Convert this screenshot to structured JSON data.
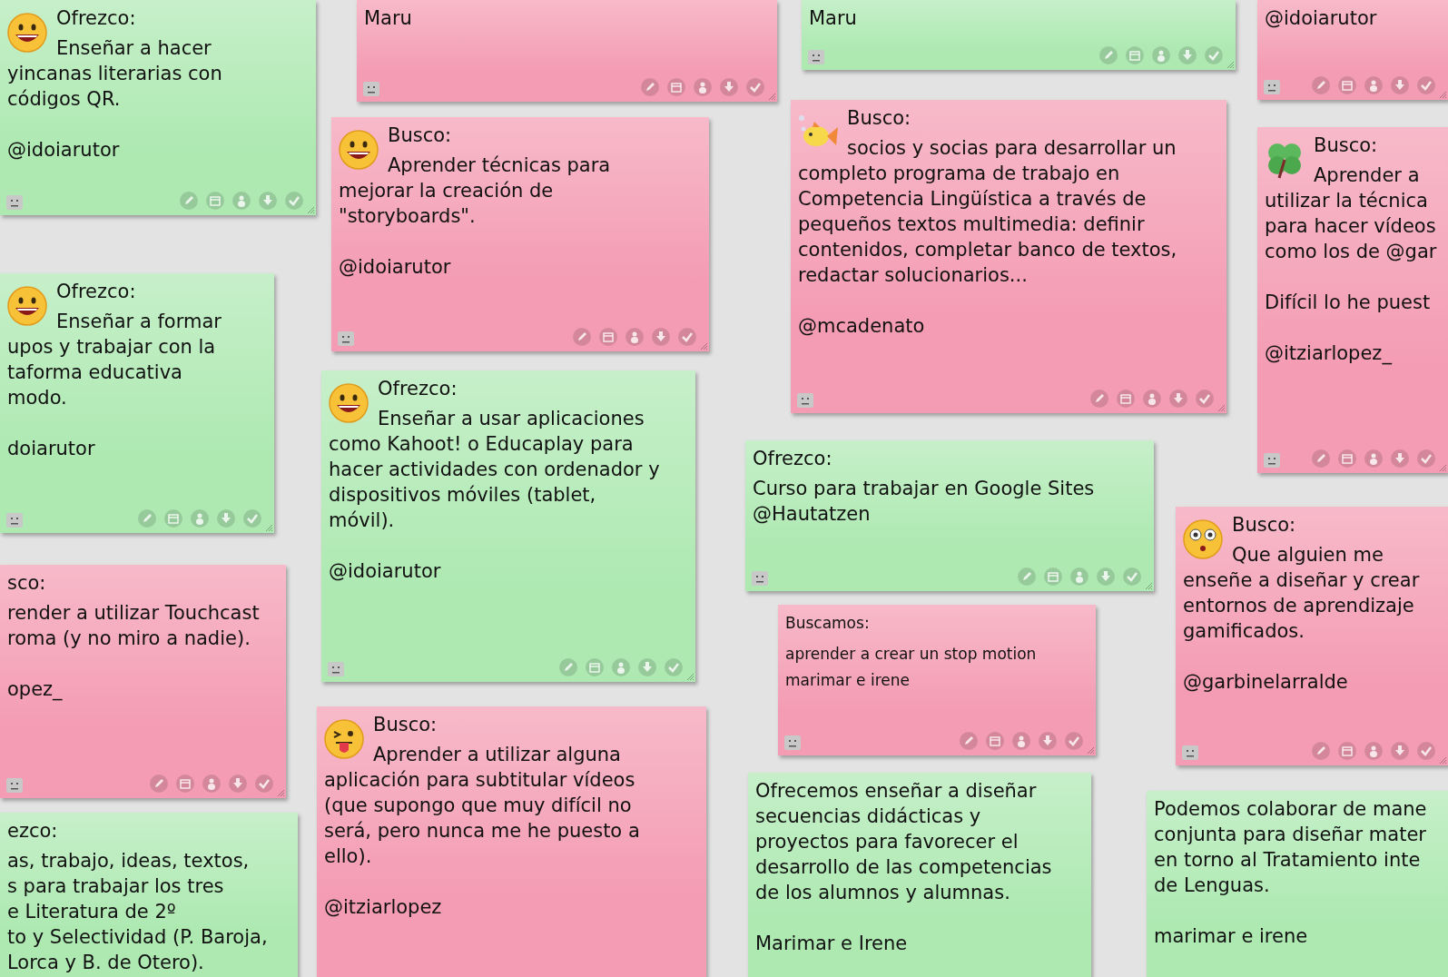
{
  "notes": [
    {
      "color": "#aee9b2",
      "kind": "smile",
      "head": "Ofrezco:",
      "body": "Enseñar a hacer\nyincanas literarias con\ncódigos QR.",
      "author": "@idoiarutor"
    },
    {
      "color": "#aee9b2",
      "kind": "smile",
      "head": "Ofrezco:",
      "body": "Enseñar a formar\nupos y trabajar con la\ntaforma educativa\nmodo.",
      "author": "doiarutor"
    },
    {
      "color": "#f49cb3",
      "kind": "plain",
      "head": "sco:",
      "body": "render a utilizar Touchcast\nroma (y no miro a nadie).",
      "author": "opez_"
    },
    {
      "color": "#aee9b2",
      "kind": "plain",
      "head": "ezco:",
      "body": "as, trabajo, ideas, textos,\ns para trabajar los tres\ne Literatura de 2º\nto y Selectividad (P. Baroja,\nLorca y B. de Otero)."
    },
    {
      "color": "#f49cb3",
      "kind": "plain",
      "body": "Maru"
    },
    {
      "color": "#f49cb3",
      "kind": "smile",
      "head": "Busco:",
      "body": "Aprender técnicas para\nmejorar la creación de\n\"storyboards\".",
      "author": "@idoiarutor"
    },
    {
      "color": "#aee9b2",
      "kind": "smile",
      "head": "Ofrezco:",
      "body": "Enseñar a usar aplicaciones\ncomo Kahoot! o Educaplay para\nhacer actividades con ordenador y\ndispositivos móviles (tablet,\nmóvil).",
      "author": "@idoiarutor"
    },
    {
      "color": "#f49cb3",
      "kind": "tongue",
      "head": "Busco:",
      "body": "Aprender a utilizar alguna\naplicación para subtitular vídeos\n(que supongo que muy difícil no\nserá, pero nunca me he puesto a\nello).",
      "author": "@itziarlopez"
    },
    {
      "color": "#aee9b2",
      "kind": "plain",
      "body": "Maru"
    },
    {
      "color": "#f49cb3",
      "kind": "fish",
      "head": "Busco:",
      "body": "socios y socias para desarrollar un\ncompleto programa de trabajo en\nCompetencia Lingüística a través de\npequeños textos multimedia: definir\ncontenidos, completar banco de textos,\nredactar solucionarios...",
      "author": "@mcadenato"
    },
    {
      "color": "#aee9b2",
      "kind": "plain",
      "head": "Ofrezco:",
      "body": "Curso para trabajar en Google Sites\n@Hautatzen"
    },
    {
      "color": "#f49cb3",
      "kind": "plain",
      "head": "Buscamos:",
      "body": "aprender a crear un stop motion\nmarimar e irene"
    },
    {
      "color": "#aee9b2",
      "kind": "plain",
      "body": "Ofrecemos enseñar a diseñar\nsecuencias didácticas y\nproyectos para favorecer el\ndesarrollo de las competencias\nde los alumnos y alumnas.",
      "author": "Marimar e Irene"
    },
    {
      "color": "#f49cb3",
      "kind": "plain",
      "body": "@idoiarutor"
    },
    {
      "color": "#f49cb3",
      "kind": "clover",
      "head": "Busco:",
      "body": "Aprender a\nutilizar la técnica\npara hacer vídeos\ncomo los de @gar\n\nDifícil lo he puest",
      "author": "@itziarlopez_"
    },
    {
      "color": "#f49cb3",
      "kind": "surprised",
      "head": "Busco:",
      "body": "Que alguien me\nenseñe a diseñar y crear\nentornos de aprendizaje\ngamificados.",
      "author": "@garbinelarralde"
    },
    {
      "color": "#aee9b2",
      "kind": "plain",
      "body": "Podemos colaborar de mane\nconjunta para diseñar mater\nen torno al Tratamiento inte\nde Lenguas.",
      "author": "marimar e irene"
    }
  ]
}
